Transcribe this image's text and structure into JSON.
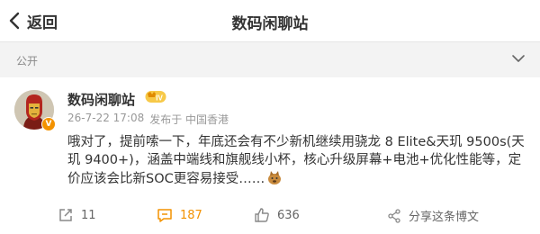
{
  "nav": {
    "back_label": "返回",
    "title": "数码闲聊站"
  },
  "visibility": {
    "label": "公开"
  },
  "post": {
    "username": "数码闲聊站",
    "level": "IV",
    "verified_mark": "V",
    "date": "26-7-22 17:08",
    "source": "发布于 中国香港",
    "text": "哦对了，提前嗦一下，年底还会有不少新机继续用骁龙 8 Elite&天玑 9500s(天玑 9400+)，涵盖中端线和旗舰线小杯，核心升级屏幕+电池+优化性能等，定价应该会比新SOC更容易接受……",
    "emoji": "doge-emoji"
  },
  "actions": {
    "repost_count": "11",
    "comment_count": "187",
    "like_count": "636",
    "share_label": "分享这条博文"
  },
  "colors": {
    "accent": "#f39200",
    "background": "#f3f3f3",
    "text": "#333333",
    "muted": "#999999"
  }
}
